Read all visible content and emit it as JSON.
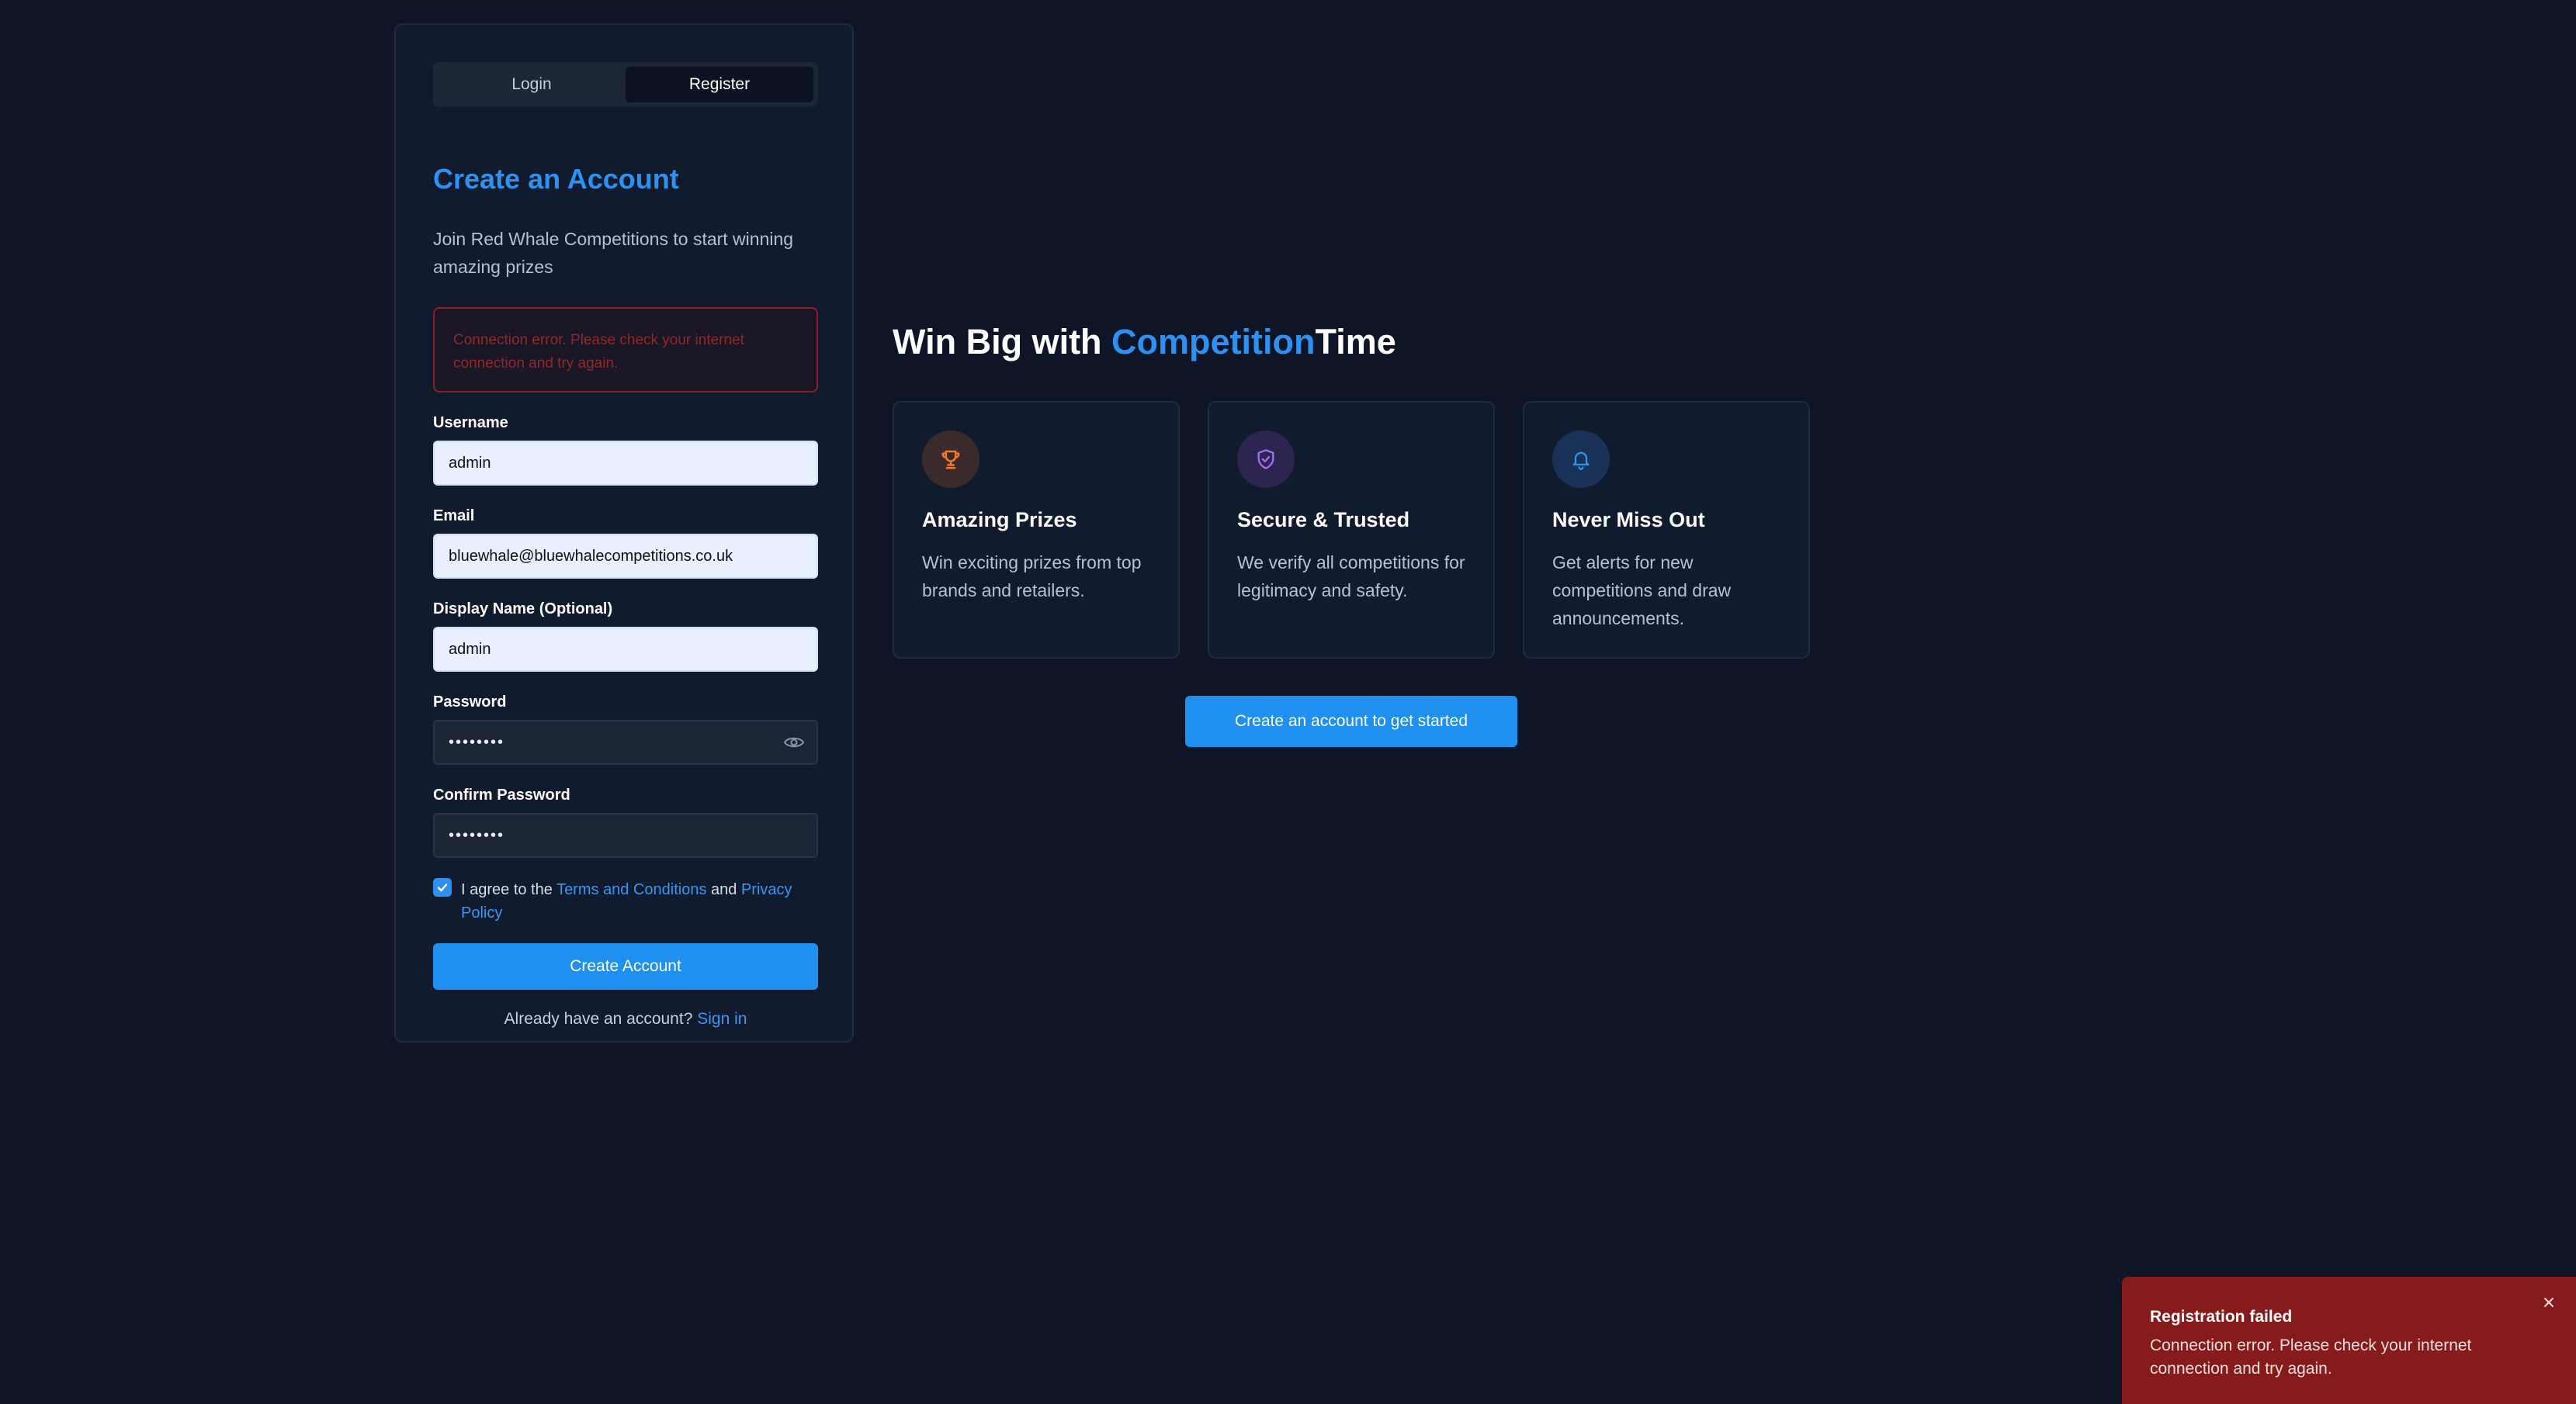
{
  "tabs": {
    "login": "Login",
    "register": "Register"
  },
  "form": {
    "title": "Create an Account",
    "subtitle": "Join Red Whale Competitions to start winning amazing prizes",
    "error": "Connection error. Please check your internet connection and try again.",
    "fields": {
      "username": {
        "label": "Username",
        "value": "admin"
      },
      "email": {
        "label": "Email",
        "value": "bluewhale@bluewhalecompetitions.co.uk"
      },
      "display_name": {
        "label": "Display Name (Optional)",
        "value": "admin"
      },
      "password": {
        "label": "Password",
        "value": "••••••••"
      },
      "confirm_password": {
        "label": "Confirm Password",
        "value": "••••••••"
      }
    },
    "agree": {
      "prefix": "I agree to the ",
      "terms": "Terms and Conditions",
      "and": " and ",
      "privacy": "Privacy Policy",
      "checked": true
    },
    "submit": "Create Account",
    "signin_prompt": "Already have an account? ",
    "signin_link": "Sign in"
  },
  "hero": {
    "prefix": "Win Big with ",
    "accent": "Competition",
    "suffix": "Time"
  },
  "features": [
    {
      "icon": "trophy-icon",
      "title": "Amazing Prizes",
      "text": "Win exciting prizes from top brands and retailers."
    },
    {
      "icon": "shield-icon",
      "title": "Secure & Trusted",
      "text": "We verify all competitions for legitimacy and safety."
    },
    {
      "icon": "bell-icon",
      "title": "Never Miss Out",
      "text": "Get alerts for new competitions and draw announcements."
    }
  ],
  "cta": "Create an account to get started",
  "toast": {
    "title": "Registration failed",
    "message": "Connection error. Please check your internet connection and try again."
  },
  "colors": {
    "background": "#0e1526",
    "accent": "#2e90f0",
    "error": "#861b1b"
  }
}
